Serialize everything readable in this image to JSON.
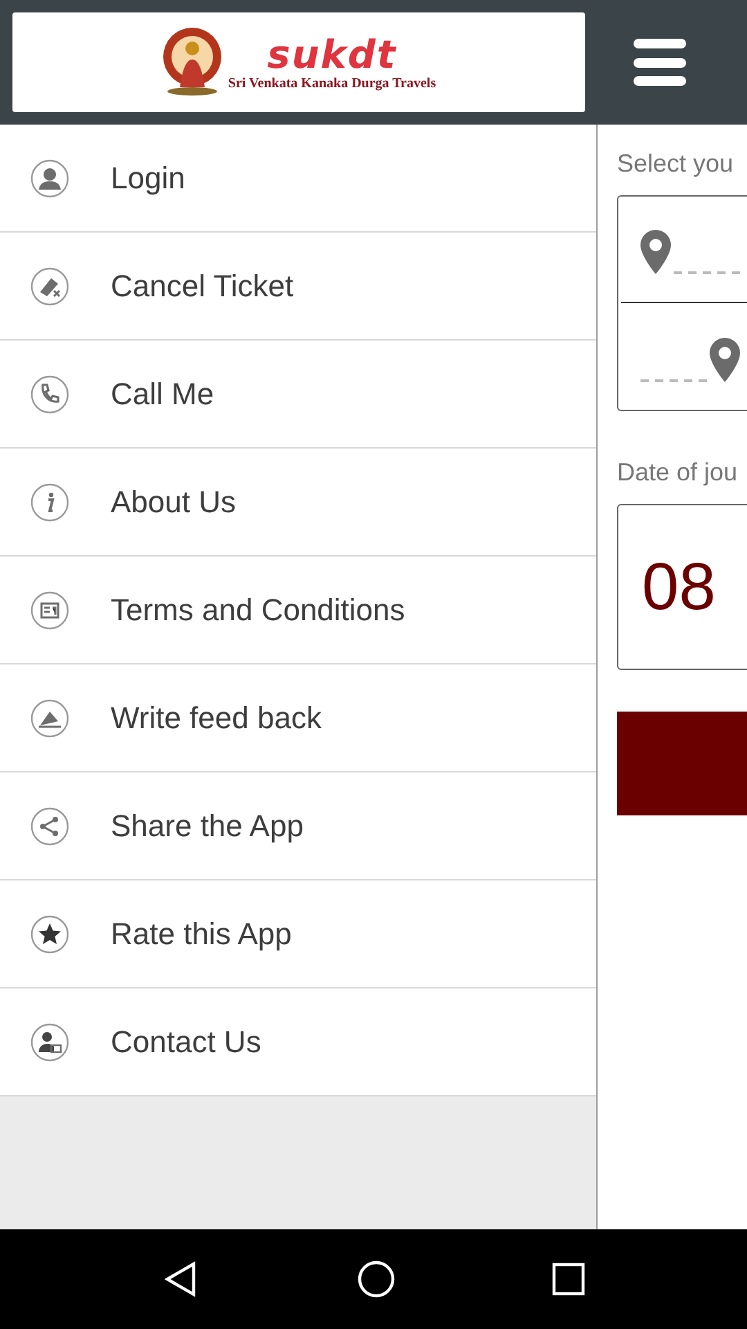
{
  "header": {
    "brand": "sukdt",
    "tagline": "Sri Venkata Kanaka Durga Travels"
  },
  "menu": [
    {
      "label": "Login",
      "kind": "user"
    },
    {
      "label": "Cancel Ticket",
      "kind": "cancel"
    },
    {
      "label": "Call Me",
      "kind": "phone"
    },
    {
      "label": "About Us",
      "kind": "info"
    },
    {
      "label": "Terms and Conditions",
      "kind": "terms"
    },
    {
      "label": "Write feed back",
      "kind": "feedback"
    },
    {
      "label": "Share the App",
      "kind": "share"
    },
    {
      "label": "Rate this App",
      "kind": "star"
    },
    {
      "label": "Contact Us",
      "kind": "contact"
    }
  ],
  "booking": {
    "route_label": "Select you",
    "date_label": "Date of jou",
    "day": "08"
  }
}
